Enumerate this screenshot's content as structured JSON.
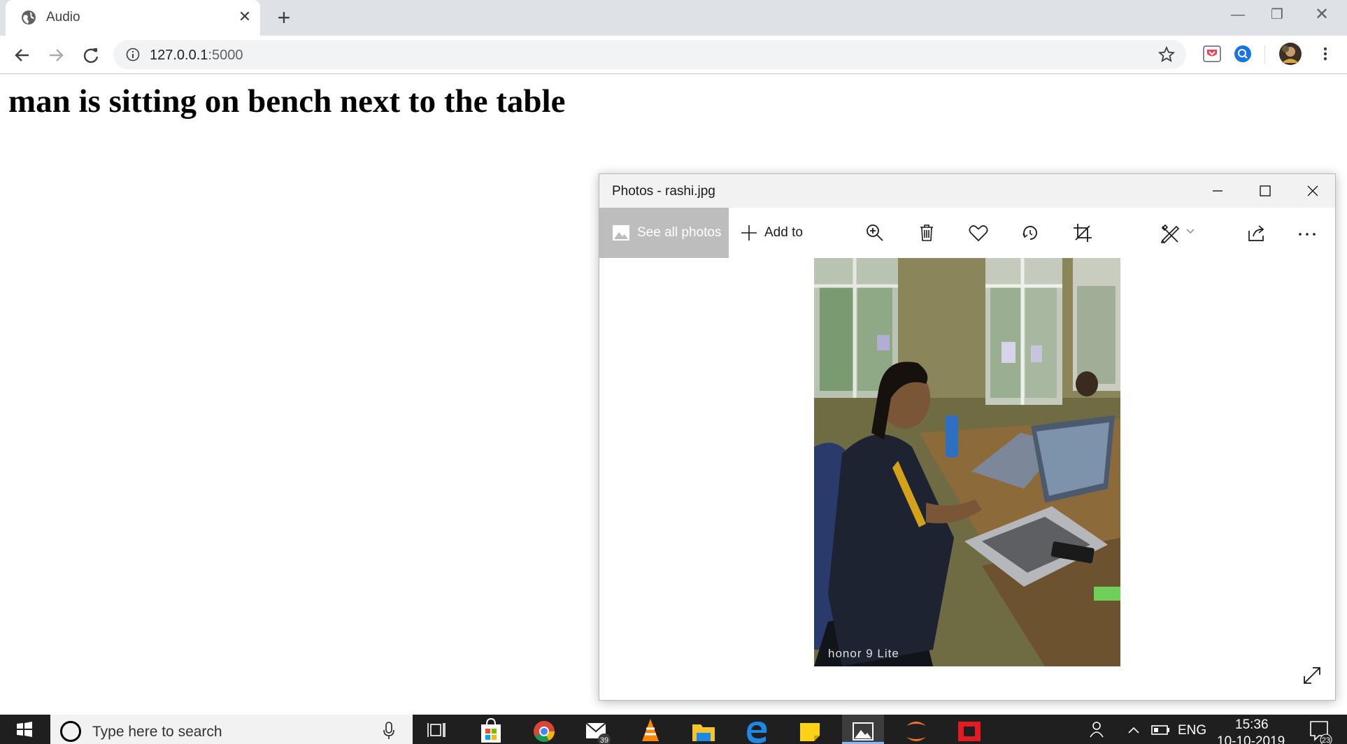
{
  "browser": {
    "tab_title": "Audio",
    "url_host": "127.0.0.1",
    "url_port": ":5000"
  },
  "page": {
    "heading": "man is sitting on bench next to the table"
  },
  "photos_app": {
    "title": "Photos - rashi.jpg",
    "see_all_label": "See all photos",
    "add_to_label": "Add to",
    "commands": [
      "zoom-icon",
      "delete-icon",
      "favorite-icon",
      "rotate-icon",
      "crop-icon",
      "edit-icon",
      "share-icon",
      "more-icon"
    ],
    "watermark": "honor 9 Lite"
  },
  "taskbar": {
    "search_placeholder": "Type here to search",
    "mail_badge": "39",
    "language": "ENG",
    "time": "15:36",
    "date": "10-10-2019",
    "notification_count": "23"
  },
  "colors": {
    "tabstrip": "#dee1e6",
    "taskbar": "#1f1f1f",
    "see_all_bg": "#bdbdbd"
  }
}
